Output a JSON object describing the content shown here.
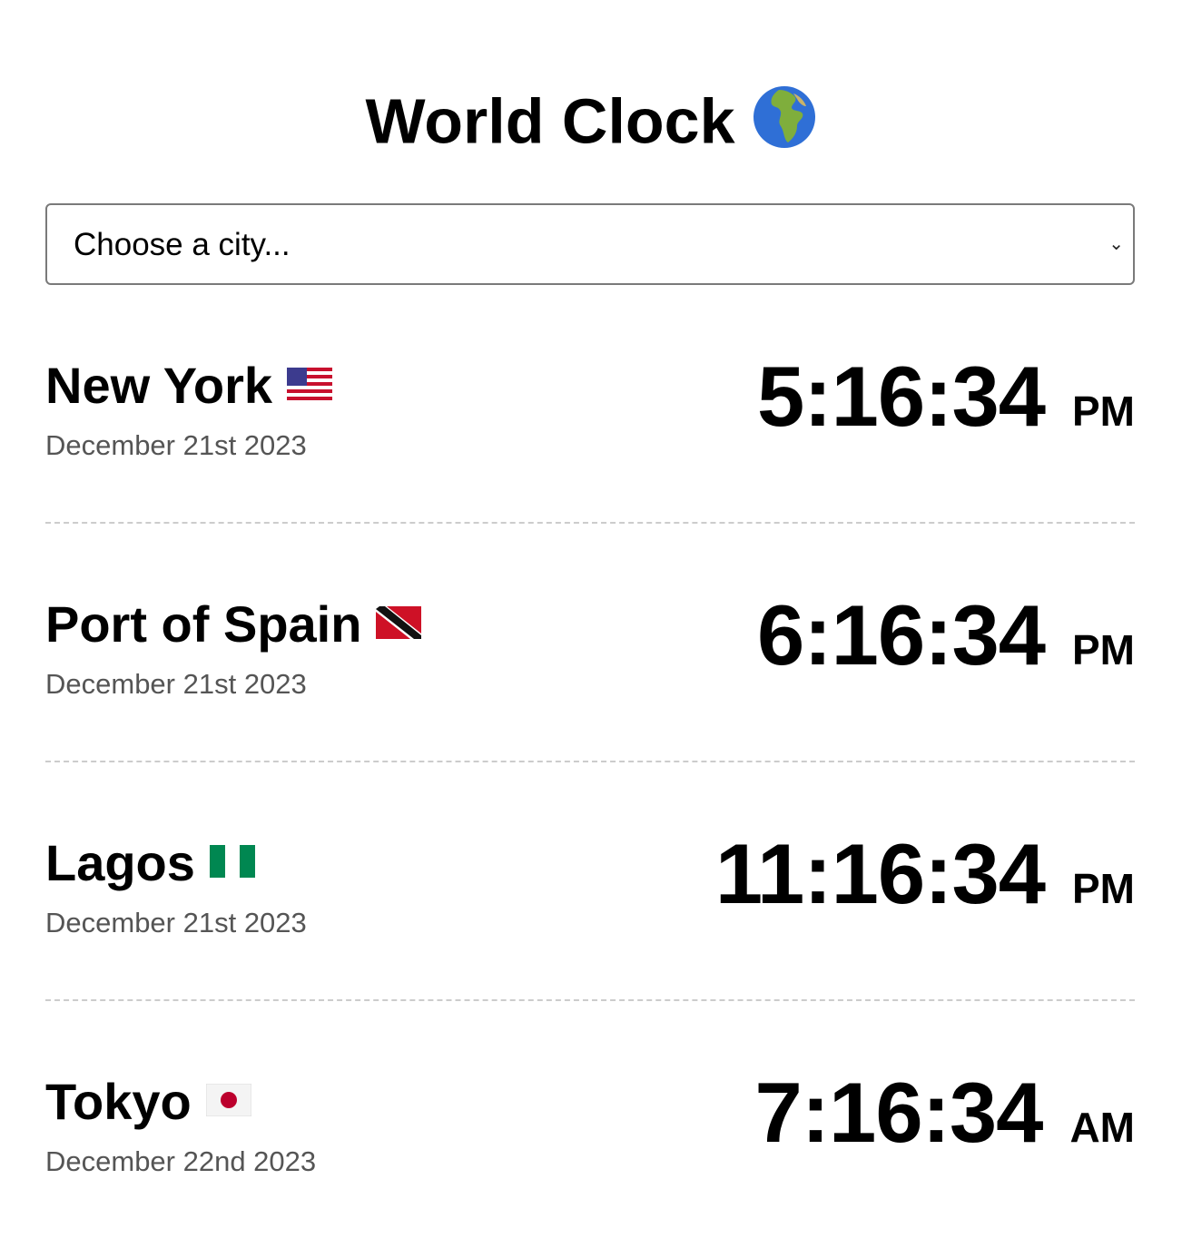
{
  "header": {
    "title": "World Clock",
    "icon": "globe-europe-africa-icon"
  },
  "city_select": {
    "placeholder": "Choose a city...",
    "icon": "chevron-down-icon"
  },
  "clocks": [
    {
      "city": "New York",
      "flag": "us-flag-icon",
      "date": "December 21st 2023",
      "time": "5:16:34",
      "period": "PM"
    },
    {
      "city": "Port of Spain",
      "flag": "trinidad-tobago-flag-icon",
      "date": "December 21st 2023",
      "time": "6:16:34",
      "period": "PM"
    },
    {
      "city": "Lagos",
      "flag": "nigeria-flag-icon",
      "date": "December 21st 2023",
      "time": "11:16:34",
      "period": "PM"
    },
    {
      "city": "Tokyo",
      "flag": "japan-flag-icon",
      "date": "December 22nd 2023",
      "time": "7:16:34",
      "period": "AM"
    }
  ]
}
